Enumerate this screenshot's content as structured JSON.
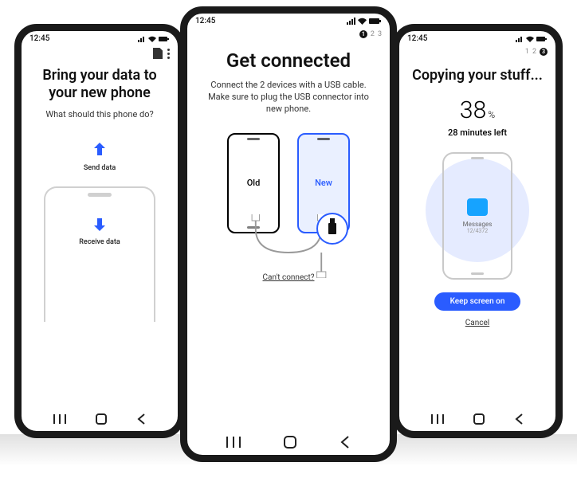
{
  "status_time": "12:45",
  "left": {
    "title": "Bring your data to your new phone",
    "subtitle": "What should this phone do?",
    "send_label": "Send data",
    "receive_label": "Receive data"
  },
  "center": {
    "step_current": "1",
    "step2": "2",
    "step3": "3",
    "title": "Get connected",
    "subtitle": "Connect the 2 devices with a USB cable. Make sure to plug the USB connector into new phone.",
    "old_label": "Old",
    "new_label": "New",
    "help_link": "Can't connect?"
  },
  "right": {
    "step1": "1",
    "step2": "2",
    "step_current": "3",
    "title": "Copying your stuff...",
    "progress_value": "38",
    "progress_unit": "%",
    "time_left": "28 minutes left",
    "item_label": "Messages",
    "item_count": "12/4372",
    "keep_on_label": "Keep screen on",
    "cancel_label": "Cancel"
  }
}
